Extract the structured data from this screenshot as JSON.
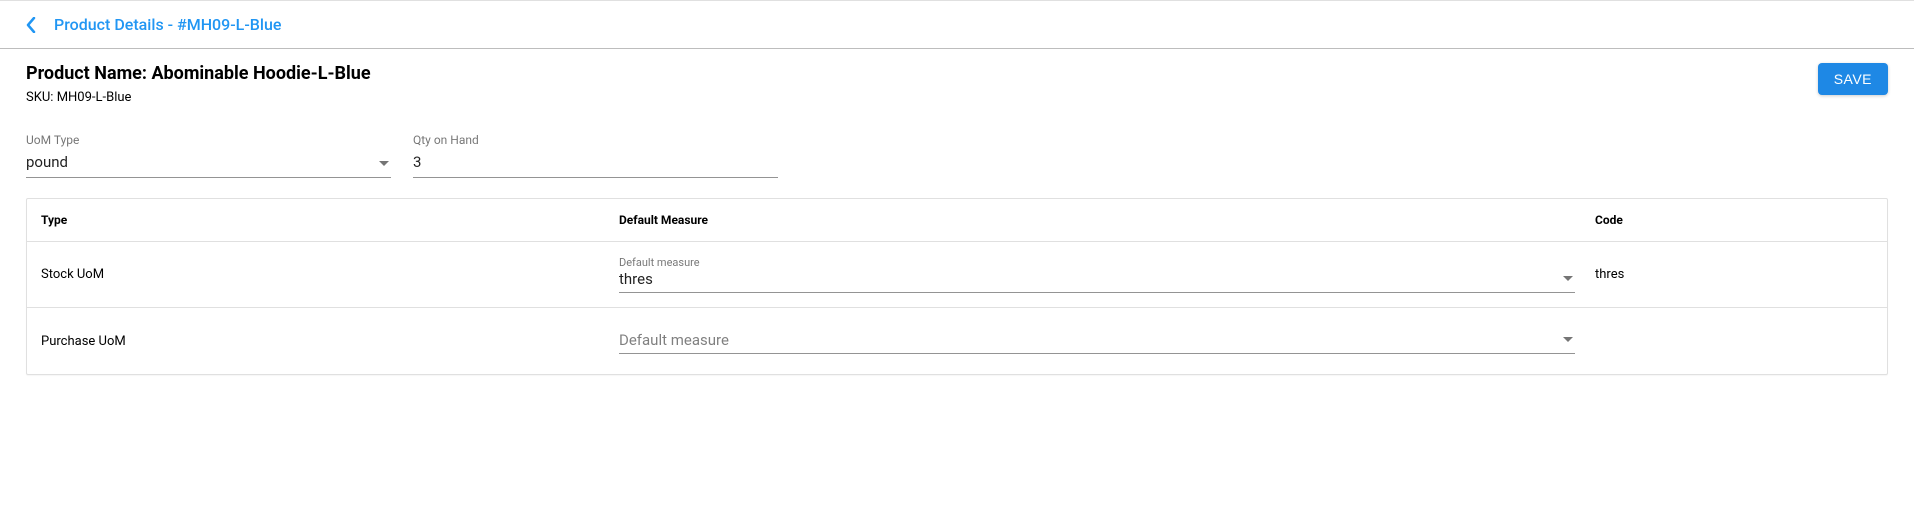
{
  "header": {
    "title": "Product Details - #MH09-L-Blue"
  },
  "product": {
    "name_prefix": "Product Name: ",
    "name": "Abominable Hoodie-L-Blue",
    "sku_prefix": "SKU: ",
    "sku": "MH09-L-Blue"
  },
  "actions": {
    "save": "SAVE"
  },
  "fields": {
    "uom_type": {
      "label": "UoM Type",
      "value": "pound"
    },
    "qty": {
      "label": "Qty on Hand",
      "value": "3"
    }
  },
  "table": {
    "headers": {
      "type": "Type",
      "measure": "Default Measure",
      "code": "Code"
    },
    "rows": [
      {
        "type": "Stock UoM",
        "measure_label": "Default measure",
        "measure_value": "thres",
        "measure_is_placeholder": false,
        "code": "thres"
      },
      {
        "type": "Purchase UoM",
        "measure_label": "",
        "measure_value": "Default measure",
        "measure_is_placeholder": true,
        "code": ""
      }
    ]
  }
}
